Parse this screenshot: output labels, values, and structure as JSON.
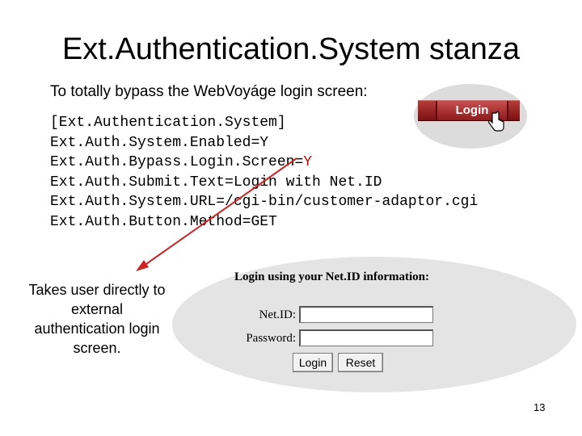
{
  "slide": {
    "title": "Ext.Authentication.System stanza",
    "intro": "To totally bypass the WebVoyáge login screen:",
    "page_number": "13"
  },
  "code": {
    "line1": "[Ext.Authentication.System]",
    "line2": "Ext.Auth.System.Enabled=Y",
    "line3_prefix": "Ext.Auth.Bypass.Login.Screen=",
    "line3_value": "Y",
    "line4": "Ext.Auth.Submit.Text=Login with Net.ID",
    "line5": "Ext.Auth.System.URL=/cgi-bin/customer-adaptor.cgi",
    "line6": "Ext.Auth.Button.Method=GET"
  },
  "login_button_image": {
    "label": "Login"
  },
  "side_note": "Takes user directly to external authentication login screen.",
  "netid_form": {
    "title": "Login using your Net.ID information:",
    "netid_label": "Net.ID:",
    "password_label": "Password:",
    "netid_value": "",
    "password_value": "",
    "login_button": "Login",
    "reset_button": "Reset"
  },
  "colors": {
    "highlight": "#cc0000",
    "arrow": "#d42020"
  }
}
